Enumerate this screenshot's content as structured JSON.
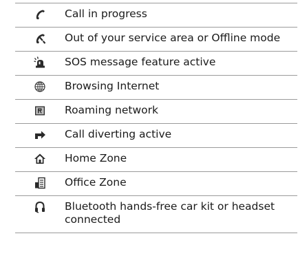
{
  "rows": [
    {
      "icon": "phone-handset-icon",
      "text": "Call in progress"
    },
    {
      "icon": "phone-no-signal-icon",
      "text": "Out of your service area or Offline mode"
    },
    {
      "icon": "sos-siren-icon",
      "text": "SOS message feature active"
    },
    {
      "icon": "globe-icon",
      "text": "Browsing Internet"
    },
    {
      "icon": "roaming-r-icon",
      "text": "Roaming network"
    },
    {
      "icon": "call-divert-arrow-icon",
      "text": "Call diverting active"
    },
    {
      "icon": "home-icon",
      "text": "Home Zone"
    },
    {
      "icon": "office-building-icon",
      "text": "Office Zone"
    },
    {
      "icon": "bluetooth-headset-icon",
      "text": "Bluetooth hands-free car kit or headset connected"
    }
  ]
}
